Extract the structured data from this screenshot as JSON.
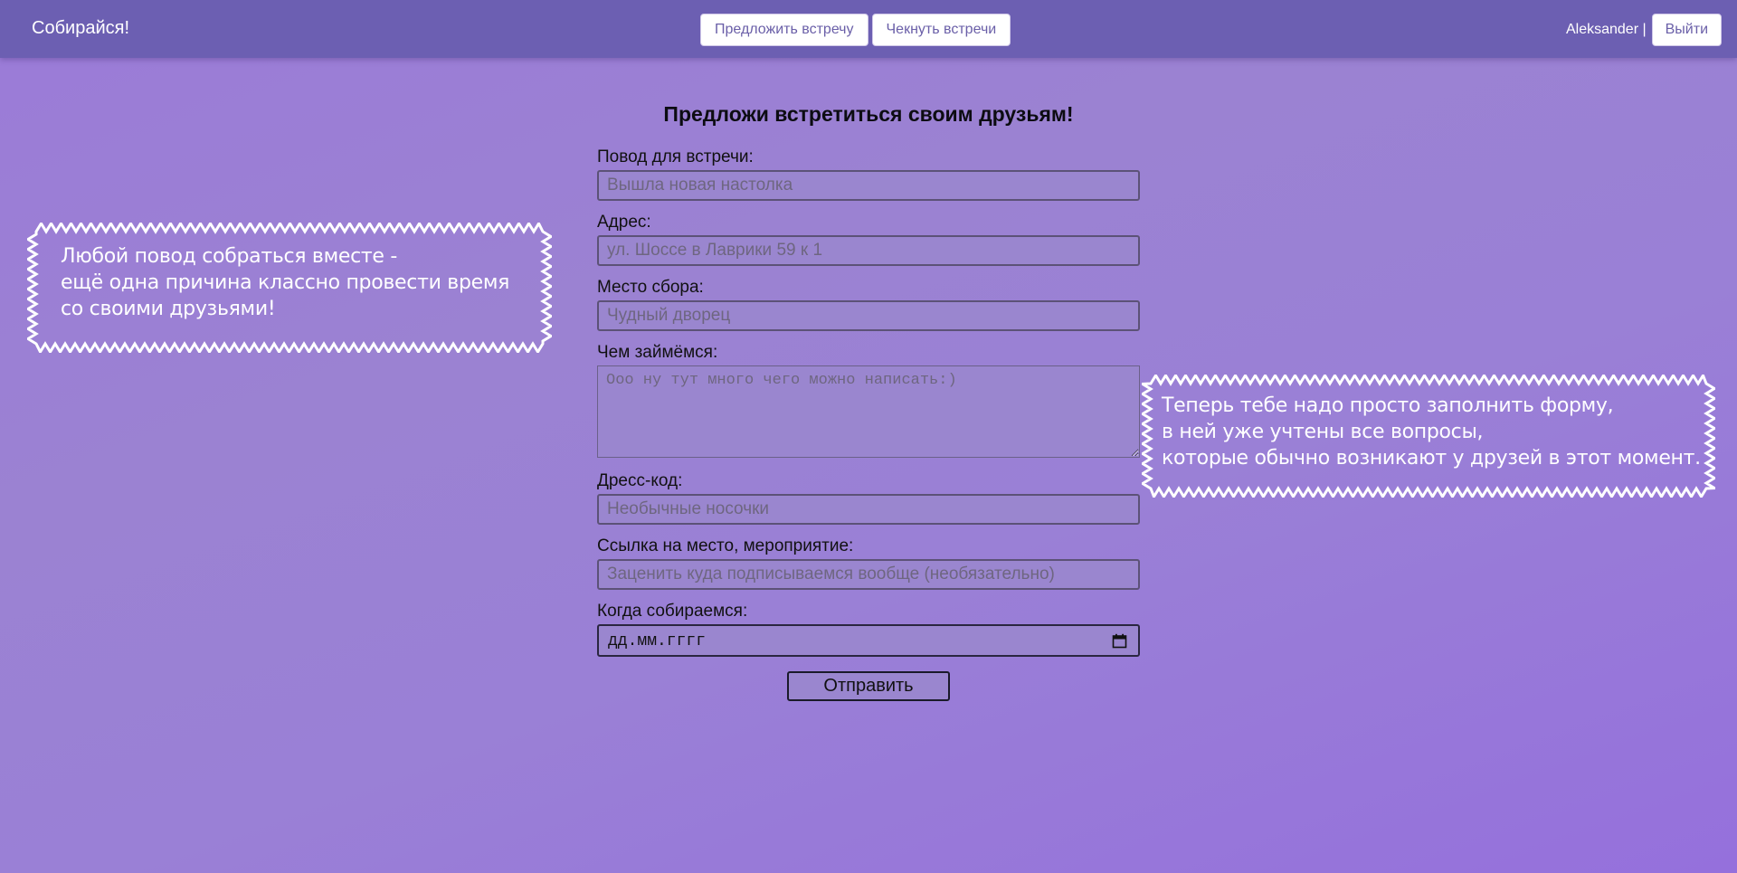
{
  "navbar": {
    "brand": "Собирайся!",
    "propose_label": "Предложить встречу",
    "check_label": "Чекнуть встречи",
    "username": "Aleksander |",
    "logout_label": "Выйти"
  },
  "form": {
    "title": "Предложи встретиться своим друзьям!",
    "reason": {
      "label": "Повод для встречи:",
      "placeholder": "Вышла новая настолка",
      "value": ""
    },
    "address": {
      "label": "Адрес:",
      "placeholder": "ул. Шоссе в Лаврики 59 к 1",
      "value": ""
    },
    "meeting_place": {
      "label": "Место сбора:",
      "placeholder": "Чудный дворец",
      "value": ""
    },
    "activity": {
      "label": "Чем займёмся:",
      "placeholder": "Ооо ну тут много чего можно написать:)",
      "value": ""
    },
    "dress_code": {
      "label": "Дресс-код:",
      "placeholder": "Необычные носочки",
      "value": ""
    },
    "link": {
      "label": "Ссылка на место, мероприятие:",
      "placeholder": "Заценить куда подписываемся вообще (необязательно)",
      "value": ""
    },
    "date": {
      "label": "Когда собираемся:",
      "display": "дд.мм.гггг"
    },
    "submit_label": "Отправить"
  },
  "callouts": {
    "left": [
      "Любой повод собраться вместе -",
      "ещё одна причина классно провести время",
      "со своими друзьями!"
    ],
    "right": [
      "Теперь тебе надо просто заполнить форму,",
      "в ней уже учтены все вопросы,",
      "которые обычно возникают у друзей в этот момент."
    ]
  },
  "colors": {
    "navbar": "#6c5fb2",
    "background": "#9b80d6",
    "accent_text": "#6a5fa8"
  },
  "icons": {
    "date_picker": "calendar-icon"
  }
}
